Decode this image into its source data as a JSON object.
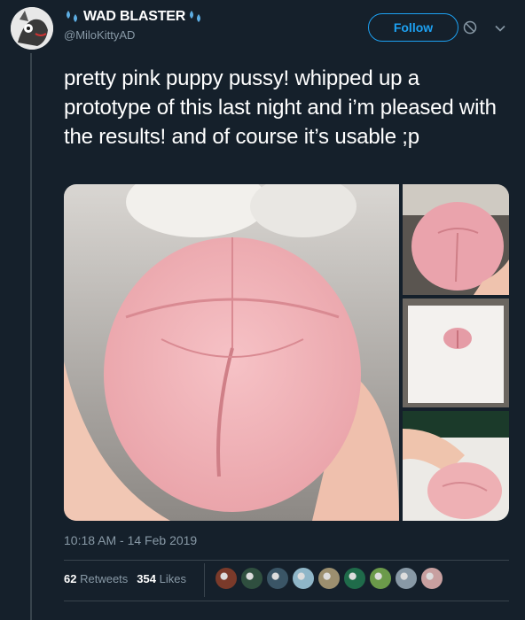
{
  "user": {
    "display_name": "WAD BLASTER",
    "handle": "@MiloKittyAD"
  },
  "actions": {
    "follow_label": "Follow",
    "block_icon": "block-icon",
    "menu_icon": "chevron-down-icon"
  },
  "tweet": {
    "text": "pretty pink puppy pussy! whipped up a prototype of this last night and i’m pleased with the results! and of course it’s usable ;p",
    "timestamp": "10:18 AM - 14 Feb 2019"
  },
  "stats": {
    "retweets_count": "62",
    "retweets_label": "Retweets",
    "likes_count": "354",
    "likes_label": "Likes"
  },
  "likers": [
    {
      "color": "#7a3a2a"
    },
    {
      "color": "#2f4f3f"
    },
    {
      "color": "#3a5566"
    },
    {
      "color": "#8fb6c8"
    },
    {
      "color": "#9c8f6f"
    },
    {
      "color": "#1f6b4a"
    },
    {
      "color": "#6b9a4a"
    },
    {
      "color": "#8899a6"
    },
    {
      "color": "#c8a0a0"
    }
  ],
  "colors": {
    "background": "#15202b",
    "accent": "#1da1f2",
    "muted": "#8899a6"
  }
}
